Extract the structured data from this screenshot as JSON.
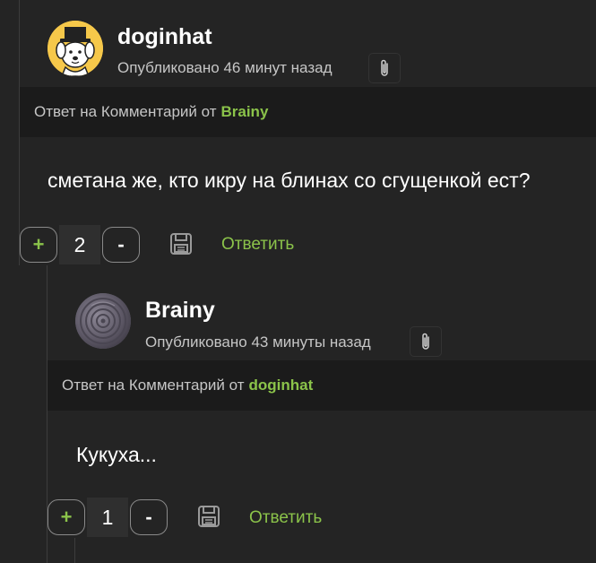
{
  "comments": [
    {
      "author": "doginhat",
      "posted": "Опубликовано 46 минут назад",
      "reply_prefix": "Ответ на Комментарий от",
      "reply_to": "Brainy",
      "text": "сметана же, кто икру на блинах со сгущенкой ест?",
      "plus": "+",
      "score": "2",
      "minus": "-",
      "reply_label": "Ответить",
      "avatar_icon": "dog-with-top-hat-avatar",
      "attach_icon": "paperclip-icon",
      "save_icon": "floppy-disk-icon"
    },
    {
      "author": "Brainy",
      "posted": "Опубликовано 43 минуты назад",
      "reply_prefix": "Ответ на Комментарий от",
      "reply_to": "doginhat",
      "text": "Кукуха...",
      "plus": "+",
      "score": "1",
      "minus": "-",
      "reply_label": "Ответить",
      "avatar_icon": "manhole-cover-avatar",
      "attach_icon": "paperclip-icon",
      "save_icon": "floppy-disk-icon"
    }
  ],
  "colors": {
    "background": "#242424",
    "reply_bar": "#1b1b1b",
    "accent_green": "#8bc34a",
    "muted_text": "#c6c6c6",
    "thread_line": "#3c3c3c"
  }
}
